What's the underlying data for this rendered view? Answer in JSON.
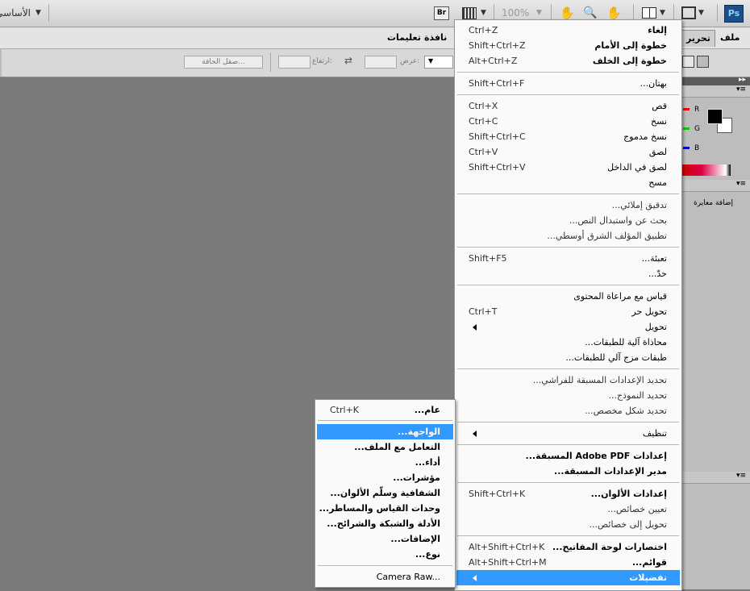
{
  "appbar": {
    "logo": "Ps",
    "bridge": "Br",
    "zoom": "100%",
    "workspace": "الأساسي"
  },
  "menubar": {
    "file": "ملف",
    "edit": "تحرير",
    "window": "نافذة",
    "help": "تعليمات"
  },
  "options": {
    "refine_edge": "صقل الحافة...",
    "width_label": "عرض:",
    "height_label": "ارتفاع:"
  },
  "panel": {
    "r": "R",
    "g": "G",
    "b": "B",
    "add_adjustment": "إضافة معايرة"
  },
  "edit_menu": {
    "items": [
      {
        "label": "إلغاء",
        "shortcut": "Ctrl+Z"
      },
      {
        "label": "خطوة إلى الأمام",
        "shortcut": "Shift+Ctrl+Z"
      },
      {
        "label": "خطوة إلى الخلف",
        "shortcut": "Alt+Ctrl+Z"
      },
      {
        "label": "بهتان...",
        "shortcut": "Shift+Ctrl+F"
      },
      {
        "label": "قص",
        "shortcut": "Ctrl+X"
      },
      {
        "label": "نسخ",
        "shortcut": "Ctrl+C"
      },
      {
        "label": "نسخ مدموج",
        "shortcut": "Shift+Ctrl+C"
      },
      {
        "label": "لصق",
        "shortcut": "Ctrl+V"
      },
      {
        "label": "لصق في الداخل",
        "shortcut": "Shift+Ctrl+V"
      },
      {
        "label": "مسح",
        "shortcut": ""
      },
      {
        "label": "تدقيق إملائي...",
        "shortcut": ""
      },
      {
        "label": "بحث عن واستبدال النص...",
        "shortcut": ""
      },
      {
        "label": "تطبيق المؤلف الشرق أوسطي...",
        "shortcut": ""
      },
      {
        "label": "تعبئة...",
        "shortcut": "Shift+F5"
      },
      {
        "label": "حدّ...",
        "shortcut": ""
      },
      {
        "label": "قياس مع مراعاة المحتوى",
        "shortcut": ""
      },
      {
        "label": "تحويل حر",
        "shortcut": "Ctrl+T"
      },
      {
        "label": "تحويل",
        "shortcut": ""
      },
      {
        "label": "محاذاة آلية للطبقات...",
        "shortcut": ""
      },
      {
        "label": "طبقات مزج آلي للطبقات...",
        "shortcut": ""
      },
      {
        "label": "تحديد الإعدادات المسبقة للفراشي...",
        "shortcut": ""
      },
      {
        "label": "تحديد النموذج...",
        "shortcut": ""
      },
      {
        "label": "تحديد شكل مخصص...",
        "shortcut": ""
      },
      {
        "label": "تنظيف",
        "shortcut": ""
      },
      {
        "label": "إعدادات Adobe PDF المسبقة...",
        "shortcut": ""
      },
      {
        "label": "مدير الإعدادات المسبقة...",
        "shortcut": ""
      },
      {
        "label": "إعدادات الألوان...",
        "shortcut": "Shift+Ctrl+K"
      },
      {
        "label": "تعيين خصائص...",
        "shortcut": ""
      },
      {
        "label": "تحويل إلى خصائص...",
        "shortcut": ""
      },
      {
        "label": "اختصارات لوحة المفاتيح...",
        "shortcut": "Alt+Shift+Ctrl+K"
      },
      {
        "label": "قوائم...",
        "shortcut": "Alt+Shift+Ctrl+M"
      },
      {
        "label": "تفضيلات",
        "shortcut": ""
      }
    ]
  },
  "prefs_menu": {
    "items": [
      {
        "label": "عام...",
        "shortcut": "Ctrl+K"
      },
      {
        "label": "الواجهة...",
        "shortcut": ""
      },
      {
        "label": "التعامل مع الملف...",
        "shortcut": ""
      },
      {
        "label": "أداء...",
        "shortcut": ""
      },
      {
        "label": "مؤشرات...",
        "shortcut": ""
      },
      {
        "label": "الشفافية وسلّم الألوان...",
        "shortcut": ""
      },
      {
        "label": "وحدات القياس والمساطر...",
        "shortcut": ""
      },
      {
        "label": "الأدلة والشبكة والشرائح...",
        "shortcut": ""
      },
      {
        "label": "الإضافات...",
        "shortcut": ""
      },
      {
        "label": "نوع...",
        "shortcut": ""
      },
      {
        "label": "Camera Raw...",
        "shortcut": ""
      }
    ]
  }
}
